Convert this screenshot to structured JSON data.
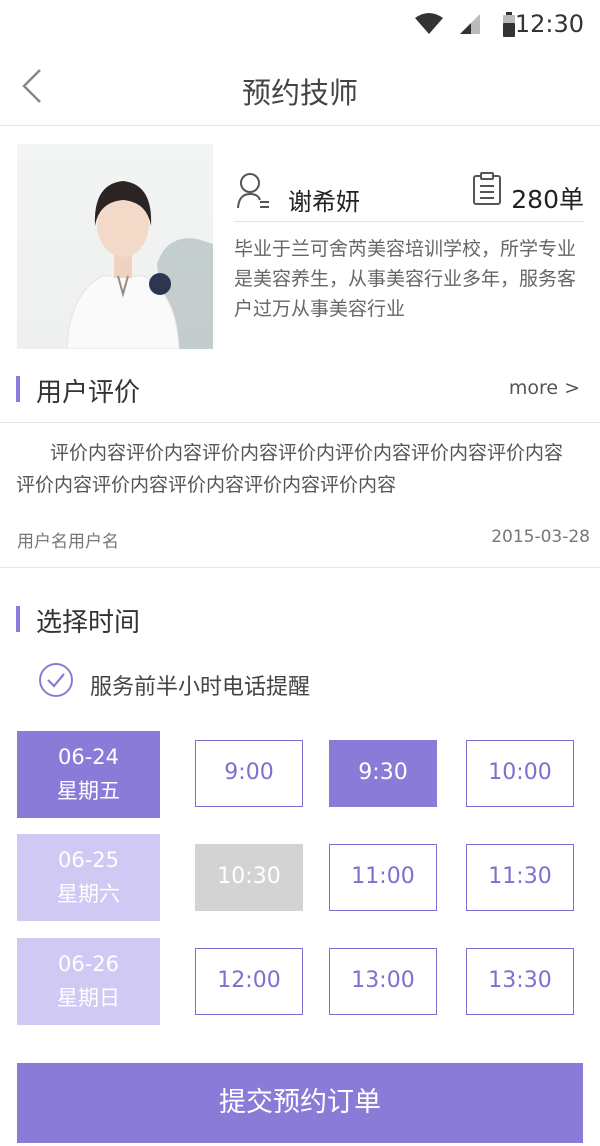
{
  "status_bar": {
    "time": "12:30"
  },
  "header": {
    "title": "预约技师"
  },
  "technician": {
    "name": "谢希妍",
    "orders": "280单",
    "bio": "毕业于兰可舍芮美容培训学校，所学专业是美容养生，从事美容行业多年，服务客户过万从事美容行业"
  },
  "reviews": {
    "section_title": "用户评价",
    "more_label": "more >",
    "item": {
      "text": "评价内容评价内容评价内容评价内评价内容评价内容评价内容评价内容评价内容评价内容评价内容评价内容",
      "user": "用户名用户名",
      "date": "2015-03-28"
    }
  },
  "schedule": {
    "section_title": "选择时间",
    "reminder_label": "服务前半小时电话提醒",
    "days": [
      {
        "date": "06-24",
        "weekday": "星期五",
        "state": "active",
        "slots": [
          {
            "time": "9:00",
            "state": "available"
          },
          {
            "time": "9:30",
            "state": "selected"
          },
          {
            "time": "10:00",
            "state": "available"
          }
        ]
      },
      {
        "date": "06-25",
        "weekday": "星期六",
        "state": "idle",
        "slots": [
          {
            "time": "10:30",
            "state": "disabled"
          },
          {
            "time": "11:00",
            "state": "available"
          },
          {
            "time": "11:30",
            "state": "available"
          }
        ]
      },
      {
        "date": "06-26",
        "weekday": "星期日",
        "state": "idle",
        "slots": [
          {
            "time": "12:00",
            "state": "available"
          },
          {
            "time": "13:00",
            "state": "available"
          },
          {
            "time": "13:30",
            "state": "available"
          }
        ]
      }
    ]
  },
  "submit_label": "提交预约订单",
  "colors": {
    "accent": "#8b7bd8",
    "accent_light": "#cfc9f3",
    "disabled": "#d3d3d3"
  }
}
